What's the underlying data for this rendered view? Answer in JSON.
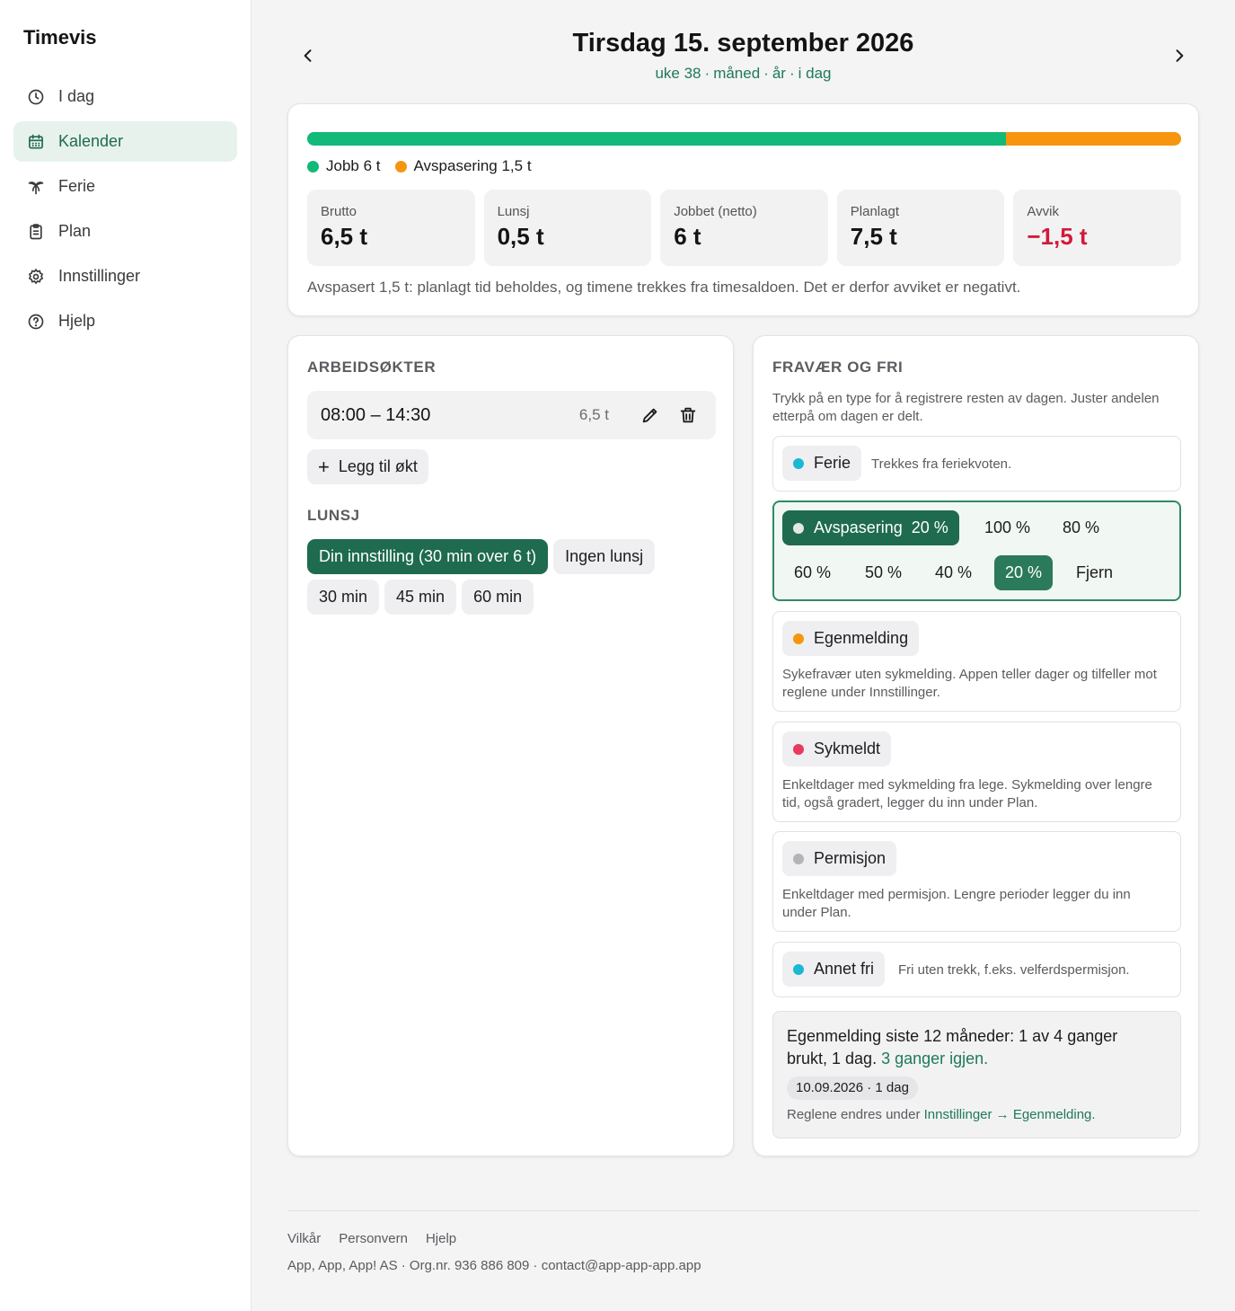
{
  "app": {
    "name": "Timevis"
  },
  "sidebar": {
    "items": [
      {
        "label": "I dag",
        "icon": "clock-icon"
      },
      {
        "label": "Kalender",
        "icon": "calendar-icon",
        "active": true
      },
      {
        "label": "Ferie",
        "icon": "palm-tree-icon"
      },
      {
        "label": "Plan",
        "icon": "clipboard-icon"
      },
      {
        "label": "Innstillinger",
        "icon": "gear-icon"
      },
      {
        "label": "Hjelp",
        "icon": "help-circle-icon"
      }
    ]
  },
  "header": {
    "title": "Tirsdag 15. september 2026",
    "links": [
      "uke 38",
      "måned",
      "år",
      "i dag"
    ],
    "separator": "·"
  },
  "summary": {
    "bar": {
      "job_fraction": 0.8,
      "avspasering_fraction": 0.2
    },
    "legend": [
      {
        "label": "Jobb 6 t",
        "color": "#12b978"
      },
      {
        "label": "Avspasering 1,5 t",
        "color": "#f7950f"
      }
    ],
    "stats": [
      {
        "label": "Brutto",
        "value": "6,5 t"
      },
      {
        "label": "Lunsj",
        "value": "0,5 t"
      },
      {
        "label": "Jobbet (netto)",
        "value": "6 t"
      },
      {
        "label": "Planlagt",
        "value": "7,5 t"
      },
      {
        "label": "Avvik",
        "value": "−1,5 t",
        "negative": true
      }
    ],
    "note": "Avspasert 1,5 t: planlagt tid beholdes, og timene trekkes fra timesaldoen. Det er derfor avviket er negativt."
  },
  "work": {
    "title": "ARBEIDSØKTER",
    "session": {
      "time": "08:00 – 14:30",
      "duration": "6,5 t"
    },
    "add_label": "Legg til økt",
    "lunch_title": "LUNSJ",
    "lunch_options": [
      {
        "label": "Din innstilling (30 min over 6 t)",
        "selected": true
      },
      {
        "label": "Ingen lunsj"
      },
      {
        "label": "30 min"
      },
      {
        "label": "45 min"
      },
      {
        "label": "60 min"
      }
    ]
  },
  "absence": {
    "title": "FRAVÆR OG FRI",
    "intro": "Trykk på en type for å registrere resten av dagen. Juster andelen etterpå om dagen er delt.",
    "ferie": {
      "label": "Ferie",
      "color": "#1bb8d4",
      "desc": "Trekkes fra feriekvoten."
    },
    "avspasering": {
      "label": "Avspasering",
      "pct": "20 %",
      "color": "#ffffff",
      "options": [
        "100 %",
        "80 %",
        "60 %",
        "50 %",
        "40 %",
        "20 %",
        "Fjern"
      ],
      "selected": "20 %"
    },
    "egenmelding": {
      "label": "Egenmelding",
      "color": "#f7950f",
      "desc": "Sykefravær uten sykmelding. Appen teller dager og tilfeller mot reglene under Innstillinger."
    },
    "sykmeldt": {
      "label": "Sykmeldt",
      "color": "#e83a5c",
      "desc": "Enkeltdager med sykmelding fra lege. Sykmelding over lengre tid, også gradert, legger du inn under Plan."
    },
    "permisjon": {
      "label": "Permisjon",
      "color": "#b4b4b8",
      "desc": "Enkeltdager med permisjon. Lengre perioder legger du inn under Plan."
    },
    "annet": {
      "label": "Annet fri",
      "color": "#1bb8d4",
      "desc": "Fri uten trekk, f.eks. velferdspermisjon."
    },
    "info": {
      "main": "Egenmelding siste 12 måneder: 1 av 4 ganger brukt, 1 dag.",
      "remaining": "3 ganger igjen.",
      "date_chip": "10.09.2026 · 1 dag",
      "rule_prefix": "Reglene endres under",
      "rule_link": "Innstillinger → Egenmelding."
    }
  },
  "footer": {
    "links": [
      "Vilkår",
      "Personvern",
      "Hjelp"
    ],
    "company": "App, App, App! AS · Org.nr. 936 886 809 · contact@app-app-app.app"
  }
}
